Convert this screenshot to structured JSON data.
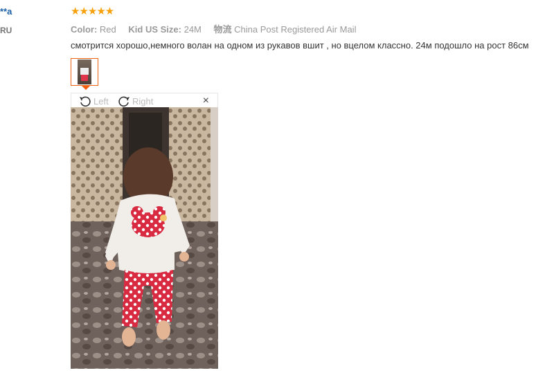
{
  "reviewer": {
    "name": "**a",
    "country": "RU"
  },
  "rating": {
    "stars": "★★★★★",
    "value": 5,
    "max": 5,
    "color": "#f7a20d"
  },
  "attributes": [
    {
      "key": "Color:",
      "value": "Red"
    },
    {
      "key": "Kid US Size:",
      "value": "24M"
    },
    {
      "key": "物流",
      "value": "China Post Registered Air Mail"
    }
  ],
  "comment": "смотрится хорошо,немного волан на одном из рукавов вшит , но вцелом классно. 24м подошло на рост 86см",
  "viewer": {
    "rotate_left_label": "Left",
    "rotate_right_label": "Right",
    "close_symbol": "×"
  },
  "colors": {
    "accent": "#f25f0e",
    "link": "#1d5fa8"
  }
}
